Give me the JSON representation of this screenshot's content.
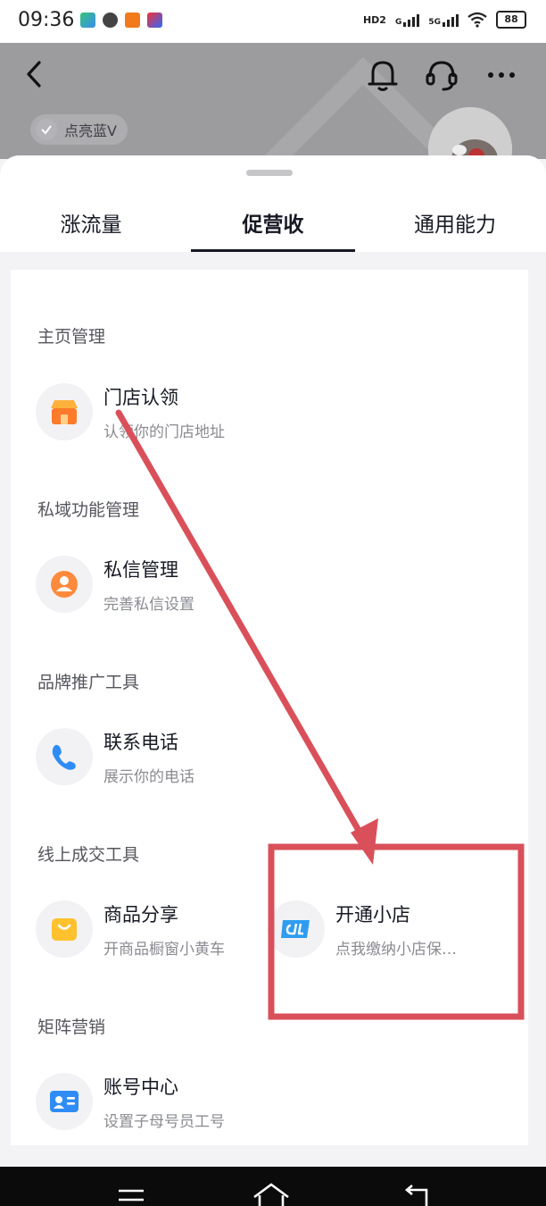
{
  "status_bar": {
    "time": "09:36",
    "network_hd": "HD2",
    "network_g": "G",
    "network_5g": "5G",
    "battery": "88"
  },
  "header": {
    "verify_badge": "点亮蓝V"
  },
  "tabs": [
    {
      "label": "涨流量",
      "active": false
    },
    {
      "label": "促营收",
      "active": true
    },
    {
      "label": "通用能力",
      "active": false
    }
  ],
  "sections": [
    {
      "title": "主页管理",
      "items": [
        {
          "title": "门店认领",
          "subtitle": "认领你的门店地址",
          "icon": "store-icon"
        }
      ]
    },
    {
      "title": "私域功能管理",
      "items": [
        {
          "title": "私信管理",
          "subtitle": "完善私信设置",
          "icon": "message-user-icon"
        }
      ]
    },
    {
      "title": "品牌推广工具",
      "items": [
        {
          "title": "联系电话",
          "subtitle": "展示你的电话",
          "icon": "phone-icon"
        }
      ]
    },
    {
      "title": "线上成交工具",
      "items": [
        {
          "title": "商品分享",
          "subtitle": "开商品橱窗小黄车",
          "icon": "shopping-bag-icon"
        },
        {
          "title": "开通小店",
          "subtitle": "点我缴纳小店保…",
          "icon": "store-logo-icon"
        }
      ]
    },
    {
      "title": "矩阵营销",
      "items": [
        {
          "title": "账号中心",
          "subtitle": "设置子母号员工号",
          "icon": "id-card-icon"
        }
      ]
    }
  ],
  "colors": {
    "accent_red": "#d9505a",
    "text_primary": "#161823",
    "text_secondary": "#8a8b91"
  }
}
